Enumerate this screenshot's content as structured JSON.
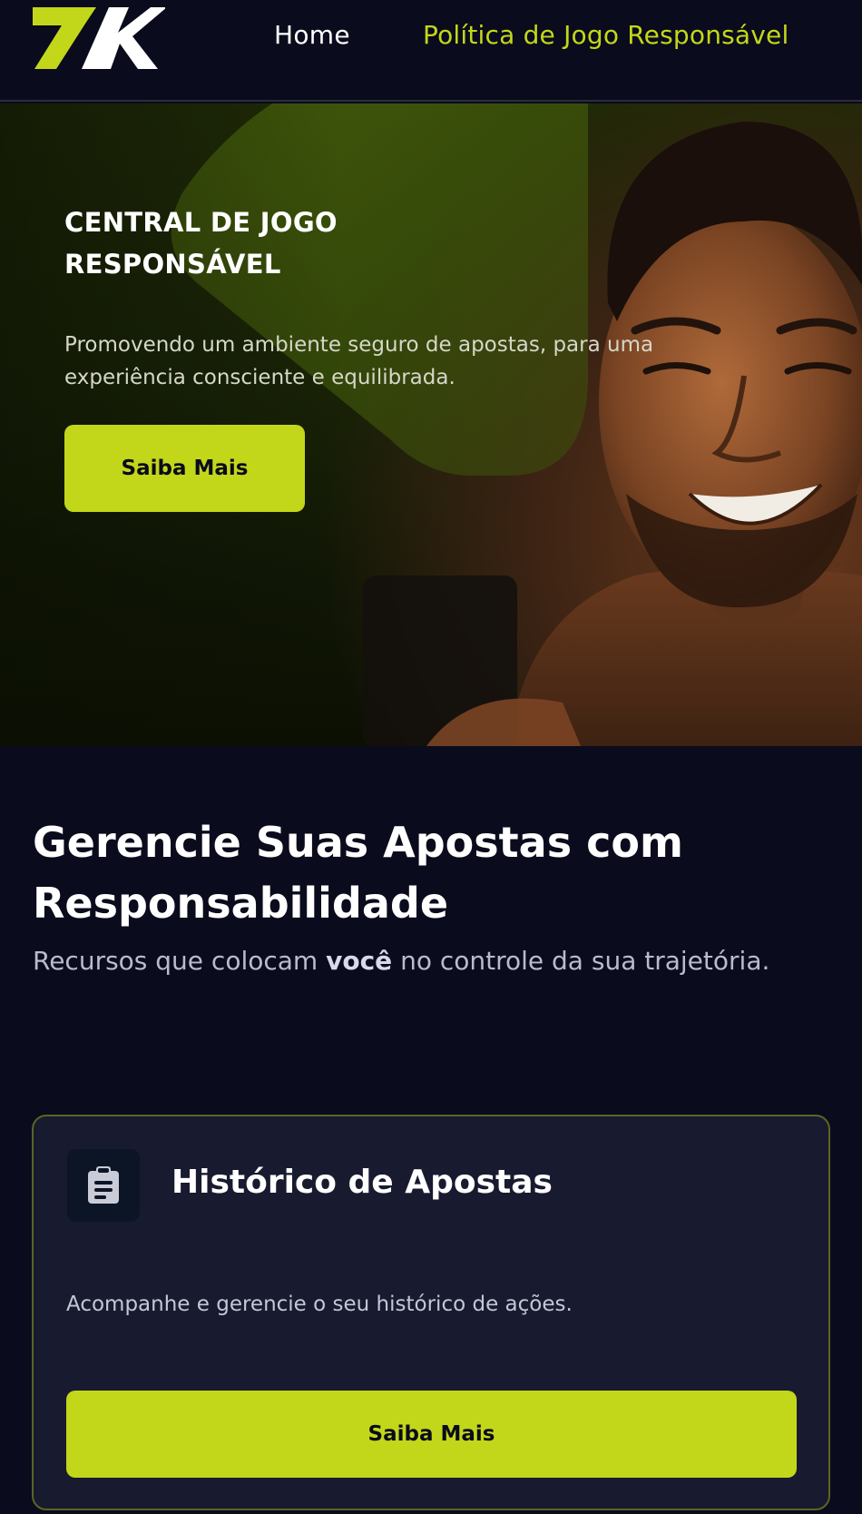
{
  "colors": {
    "accent": "#c3d71a",
    "background": "#0a0b1c",
    "card_background": "#181a30",
    "card_border": "#5b6522"
  },
  "header": {
    "logo": "7K",
    "nav": {
      "home": "Home",
      "policy": "Política de Jogo Responsável"
    }
  },
  "hero": {
    "title": "CENTRAL DE JOGO RESPONSÁVEL",
    "subtitle": "Promovendo um ambiente seguro de apostas, para uma experiência consciente e equilibrada.",
    "button": "Saiba Mais"
  },
  "section": {
    "title": "Gerencie Suas Apostas com Responsabilidade",
    "subtitle_before": "Recursos que colocam ",
    "subtitle_bold": "você",
    "subtitle_after": " no controle da sua trajetória."
  },
  "card": {
    "icon": "clipboard-icon",
    "title": "Histórico de Apostas",
    "description": "Acompanhe e gerencie o seu histórico de ações.",
    "button": "Saiba Mais"
  }
}
